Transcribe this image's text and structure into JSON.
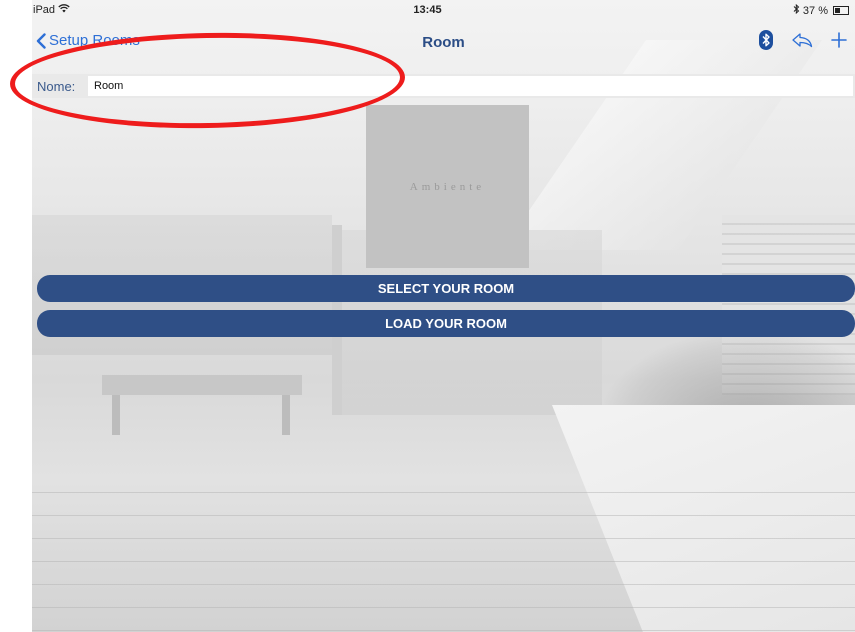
{
  "status_bar": {
    "device": "iPad",
    "time": "13:45",
    "battery": "37 %",
    "battery_level": 0.37
  },
  "nav": {
    "back_label": "Setup Rooms",
    "title": "Room"
  },
  "form": {
    "name_label": "Nome:",
    "name_value": "Room"
  },
  "room_thumbnail": {
    "label": "Ambiente"
  },
  "actions": {
    "select_label": "SELECT YOUR ROOM",
    "load_label": "LOAD YOUR ROOM"
  },
  "colors": {
    "accent": "#2d6fd6",
    "button": "#2f4f86",
    "annotation": "#ee1c1c"
  },
  "icons": [
    "wifi-icon",
    "bluetooth-icon",
    "back-chevron-icon",
    "share-icon",
    "add-icon"
  ]
}
